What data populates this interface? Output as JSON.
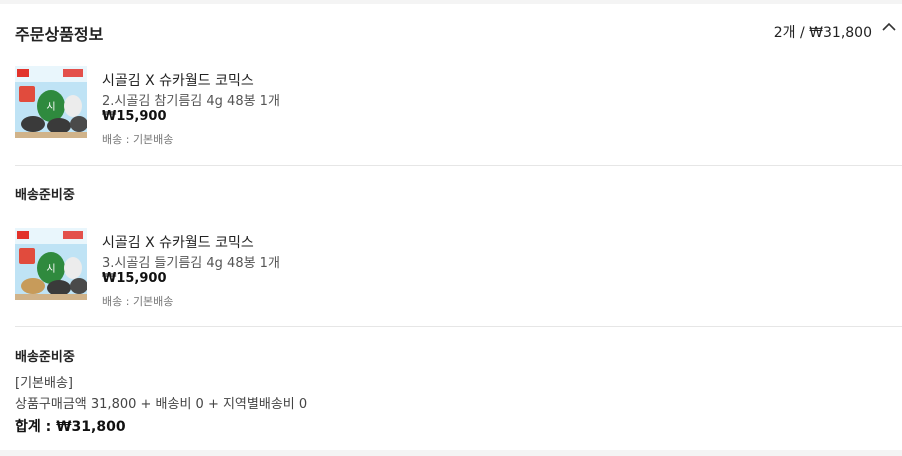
{
  "header": {
    "title": "주문상품정보",
    "summary": "2개 / ₩31,800",
    "toggle_icon": "chevron-up-icon"
  },
  "items": [
    {
      "product_name": "시골김 X 슈카월드 코믹스",
      "option": "2.시골김 참기름김 4g 48봉 1개",
      "price": "₩15,900",
      "shipping": "배송 : 기본배송",
      "image_icon": "seaweed-product-image"
    },
    {
      "product_name": "시골김 X 슈카월드 코믹스",
      "option": "3.시골김 들기름김 4g 48봉 1개",
      "price": "₩15,900",
      "shipping": "배송 : 기본배송",
      "image_icon": "seaweed-product-image"
    }
  ],
  "groups": [
    {
      "status": "배송준비중"
    },
    {
      "status": "배송준비중"
    }
  ],
  "footer": {
    "ship_type": "[기본배송]",
    "breakdown": "상품구매금액 31,800 + 배송비 0 + 지역별배송비 0",
    "total": "합계 : ₩31,800"
  }
}
